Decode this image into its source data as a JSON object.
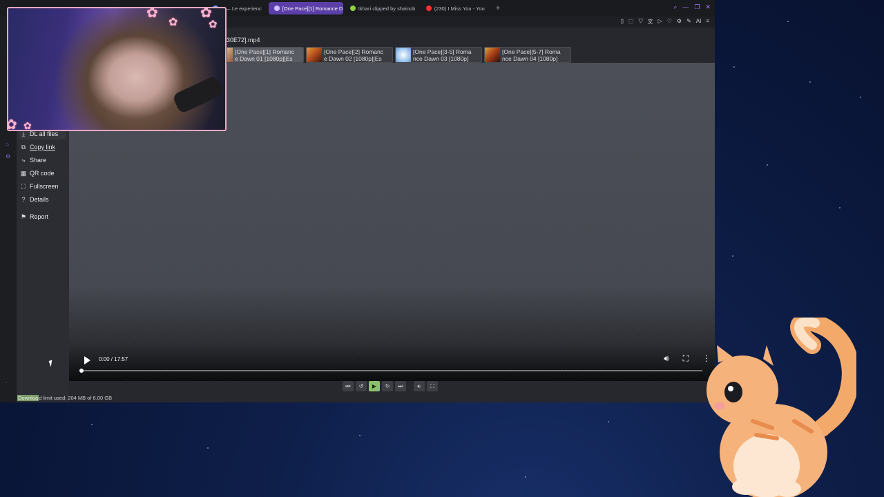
{
  "browser": {
    "tabs": [
      {
        "label": "e — Le experienc",
        "fav_color": "#6ba6ff",
        "active": false
      },
      {
        "label": "[One Pace][1] Romance D",
        "fav_color": "#cfc2ff",
        "active": true
      },
      {
        "label": "Ikhari clipped by shainob",
        "fav_color": "#8fd13f",
        "active": false
      },
      {
        "label": "(230) I Miss You - You",
        "fav_color": "#ff3030",
        "active": false
      }
    ],
    "new_tab": "+",
    "window_controls": [
      "search-icon",
      "minimize-icon",
      "restore-icon",
      "close-icon"
    ]
  },
  "toolbar": {
    "icons": [
      "bookmark-icon",
      "screenshot-icon",
      "shield-icon",
      "translate-icon",
      "play-icon",
      "heart-icon",
      "extension-icon",
      "pen-icon"
    ],
    "ai_label": "AI"
  },
  "player": {
    "filename": "30E72].mp4",
    "playlist": [
      {
        "title_line1": "[One Pace][1] Romanc",
        "title_line2": "e Dawn 01 [1080p][Es",
        "thumb": "#d2b48a"
      },
      {
        "title_line1": "[One Pace][2] Romanc",
        "title_line2": "e Dawn 02 [1080p][Es",
        "thumb": "#b54a1c"
      },
      {
        "title_line1": "[One Pace][3-5] Roma",
        "title_line2": "nce Dawn 03 [1080p]",
        "thumb": "#9ec8f0"
      },
      {
        "title_line1": "[One Pace][5-7] Roma",
        "title_line2": "nce Dawn 04 [1080p]",
        "thumb": "#a43a18"
      }
    ],
    "time_display": "0:00 / 17:57",
    "progress": 0.0
  },
  "sidemenu": {
    "items": [
      {
        "label": "DL all files",
        "icon": "download-icon",
        "glyph": "⤓"
      },
      {
        "label": "Copy link",
        "icon": "copy-icon",
        "glyph": "⧉"
      },
      {
        "label": "Share",
        "icon": "share-icon",
        "glyph": "⤷"
      },
      {
        "label": "QR code",
        "icon": "qr-icon",
        "glyph": "▦"
      },
      {
        "label": "Fullscreen",
        "icon": "fullscreen-icon",
        "glyph": "⛶"
      },
      {
        "label": "Details",
        "icon": "help-icon",
        "glyph": "?"
      },
      {
        "label": "Report",
        "icon": "flag-icon",
        "glyph": "⚑"
      }
    ]
  },
  "footer": {
    "download_highlight": "Downloa",
    "download_rest": "d limit used: 204 MB of 6.00 GB"
  }
}
